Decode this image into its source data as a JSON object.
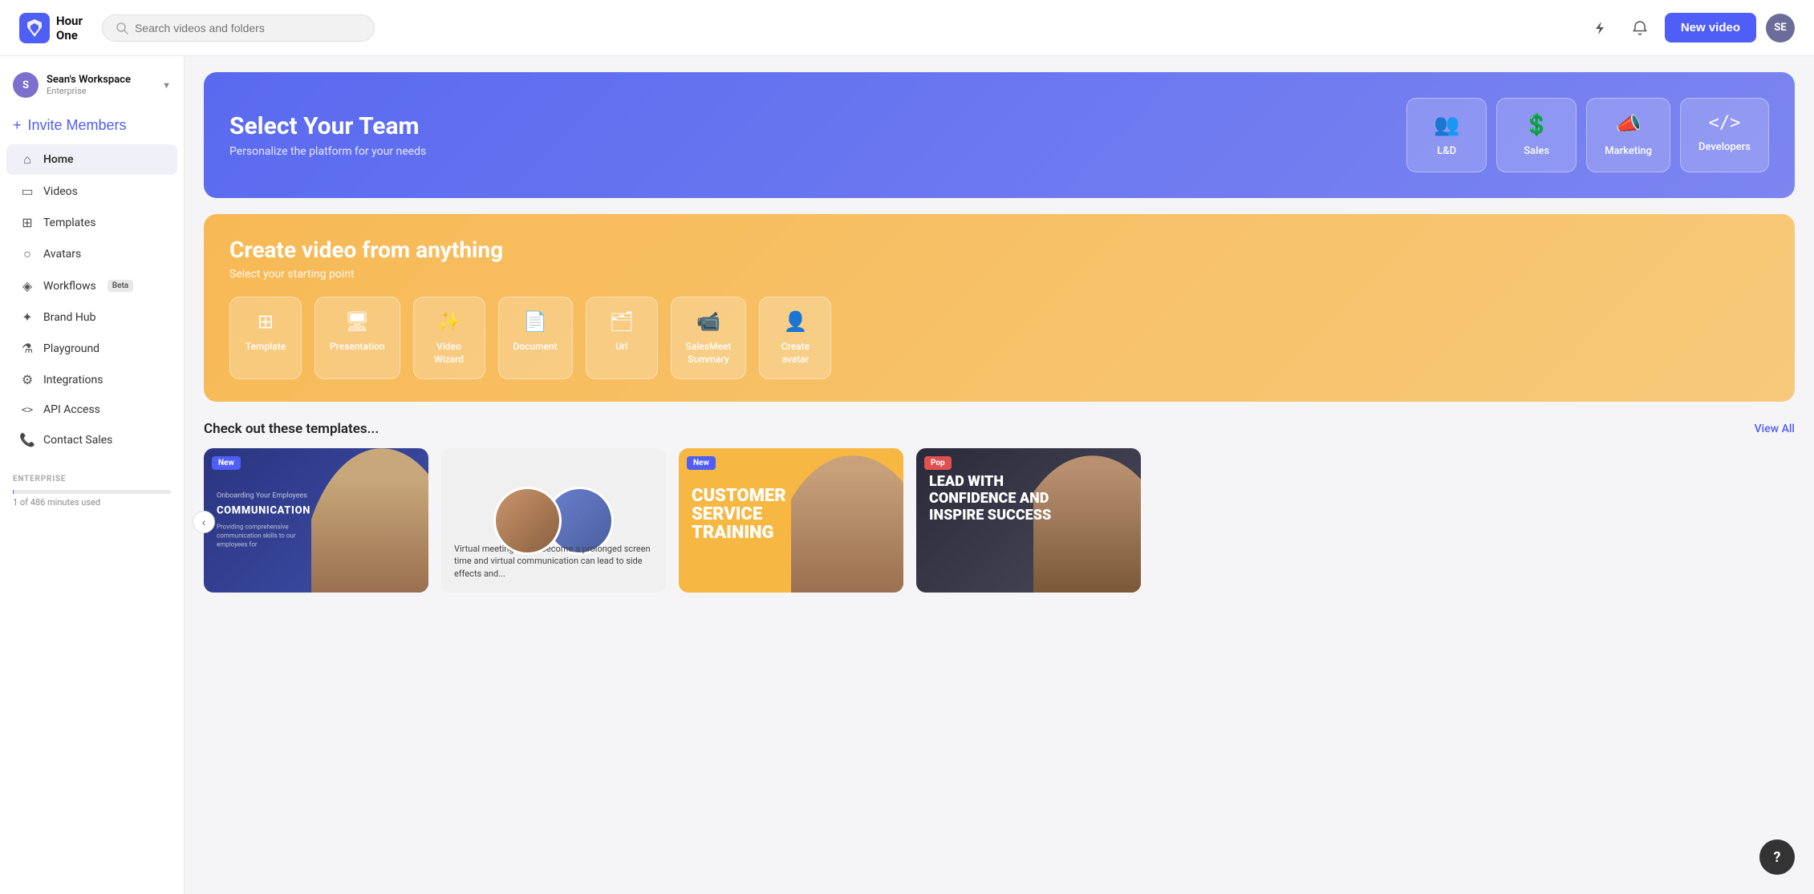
{
  "app": {
    "logo_text": "Hour\nOne",
    "search_placeholder": "Search videos and folders"
  },
  "topnav": {
    "new_video_label": "New video",
    "user_initials": "SE"
  },
  "sidebar": {
    "workspace_initial": "S",
    "workspace_name": "Sean's Workspace",
    "workspace_plan": "Enterprise",
    "invite_label": "Invite Members",
    "nav_items": [
      {
        "id": "home",
        "label": "Home",
        "icon": "🏠",
        "active": true
      },
      {
        "id": "videos",
        "label": "Videos",
        "icon": "🎬",
        "active": false
      },
      {
        "id": "templates",
        "label": "Templates",
        "icon": "⊞",
        "active": false
      },
      {
        "id": "avatars",
        "label": "Avatars",
        "icon": "👤",
        "active": false
      },
      {
        "id": "workflows",
        "label": "Workflows",
        "icon": "🎲",
        "active": false,
        "badge": "Beta"
      },
      {
        "id": "brandhub",
        "label": "Brand Hub",
        "icon": "✦",
        "active": false
      },
      {
        "id": "playground",
        "label": "Playground",
        "icon": "⚗",
        "active": false
      },
      {
        "id": "integrations",
        "label": "Integrations",
        "icon": "⚙",
        "active": false
      },
      {
        "id": "api",
        "label": "API Access",
        "icon": "<>",
        "active": false
      },
      {
        "id": "contact",
        "label": "Contact Sales",
        "icon": "📞",
        "active": false
      }
    ],
    "enterprise_label": "ENTERPRISE",
    "progress_label": "1 of 486 minutes used",
    "progress_pct": 0.2
  },
  "select_team": {
    "title": "Select Your Team",
    "subtitle": "Personalize the platform for your needs",
    "options": [
      {
        "id": "ld",
        "icon": "👥",
        "label": "L&D"
      },
      {
        "id": "sales",
        "icon": "💰",
        "label": "Sales"
      },
      {
        "id": "marketing",
        "icon": "📣",
        "label": "Marketing"
      },
      {
        "id": "developers",
        "icon": "</>",
        "label": "Developers"
      }
    ]
  },
  "create_video": {
    "title": "Create video from anything",
    "subtitle": "Select your starting point",
    "options": [
      {
        "id": "template",
        "icon": "⊞",
        "label": "Template"
      },
      {
        "id": "presentation",
        "icon": "🖥",
        "label": "Presentation"
      },
      {
        "id": "video_wizard",
        "icon": "✨",
        "label": "Video\nWizard"
      },
      {
        "id": "document",
        "icon": "📄",
        "label": "Document"
      },
      {
        "id": "url",
        "icon": "🗂",
        "label": "Url"
      },
      {
        "id": "salesmeet",
        "icon": "📹",
        "label": "SalesMeet\nSummary"
      },
      {
        "id": "avatar",
        "icon": "👤",
        "label": "Create\navatar"
      }
    ]
  },
  "templates_section": {
    "title": "Check out these templates...",
    "view_all_label": "View All",
    "cards": [
      {
        "id": "communication",
        "badge": "New",
        "badge_type": "new",
        "title": "New COMMUNICATION",
        "bg_color": "#2d3a8c",
        "text_color": "#fff"
      },
      {
        "id": "virtual_meetings",
        "badge": null,
        "title": "Virtual meetings template",
        "bg_color": "#f0f0f0",
        "text_color": "#333"
      },
      {
        "id": "customer_service",
        "badge": "New",
        "badge_type": "new",
        "title": "CUSTOMER SERVICE TRAINING",
        "bg_color": "#f7b955",
        "text_color": "#fff"
      },
      {
        "id": "lead_confidence",
        "badge": "Pop",
        "badge_type": "popular",
        "title": "LEAD WITH CONFIDENCE AND INSPIRE SUCCESS",
        "bg_color": "#3a3a4a",
        "text_color": "#fff"
      }
    ]
  },
  "help": {
    "label": "?"
  }
}
